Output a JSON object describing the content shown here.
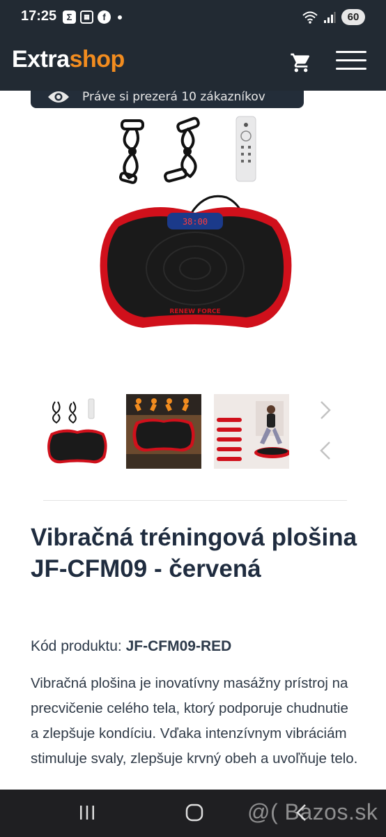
{
  "status_bar": {
    "time": "17:25",
    "notification_icons": [
      "sigma-icon",
      "calendar-icon",
      "facebook-icon",
      "dot-icon"
    ],
    "battery": "60"
  },
  "header": {
    "logo_part1": "Extra",
    "logo_part2": "shop",
    "cart_icon": "shopping-cart-icon",
    "menu_icon": "hamburger-menu-icon"
  },
  "viewers_notice": "Práve si prezerá 10 zákazníkov",
  "gallery": {
    "thumbnails": [
      {
        "alt": "vibration-plate-with-accessories"
      },
      {
        "alt": "vibration-plate-exercise-infographic"
      },
      {
        "alt": "woman-exercising-on-plate"
      }
    ]
  },
  "product": {
    "title": "Vibračná tréningová plošina JF-CFM09 - červená",
    "code_label": "Kód produktu:",
    "code_value": "JF-CFM09-RED",
    "description": "Vibračná plošina je inovatívny masážny prístroj na precvičenie celého tela, ktorý podporuje chudnutie a zlepšuje kondíciu. Vďaka intenzívnym vibráciám stimuluje svaly, zlepšuje krvný obeh a uvoľňuje telo.",
    "device_display": "38:00",
    "device_brand": "RENEW FORCE"
  },
  "watermark": "@( Bazos.sk",
  "colors": {
    "header_bg": "#222a33",
    "logo_accent": "#f28c1f",
    "product_red": "#d0101b",
    "title_text": "#1f2c3f"
  }
}
